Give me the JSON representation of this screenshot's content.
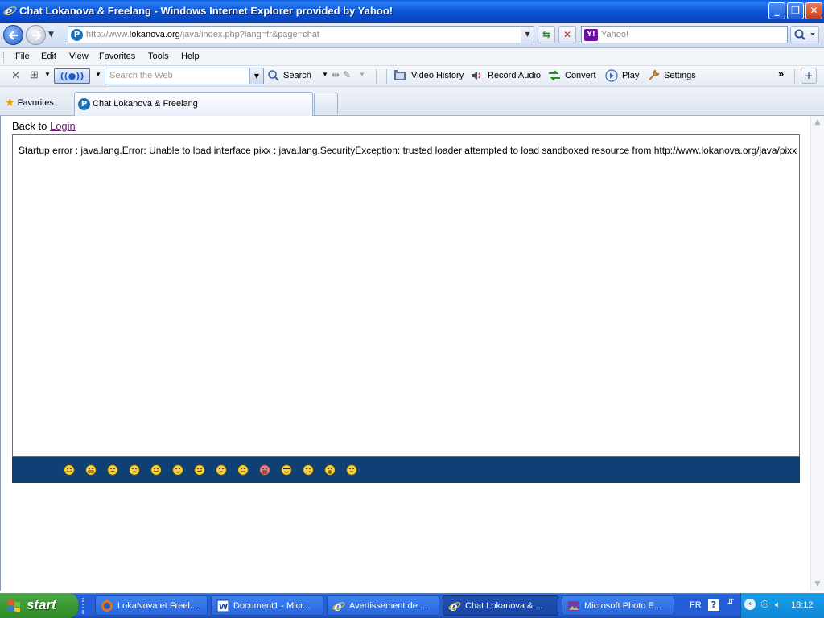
{
  "window": {
    "title": "Chat Lokanova & Freelang - Windows Internet Explorer provided by Yahoo!",
    "controls": {
      "minimize": "_",
      "maximize": "❐",
      "close": "✕"
    }
  },
  "address_bar": {
    "url_prefix": "http://www.",
    "url_host": "lokanova.org",
    "url_path": "/java/index.php?lang=fr&page=chat",
    "search_placeholder": "Yahoo!"
  },
  "menu": {
    "items": [
      "File",
      "Edit",
      "View",
      "Favorites",
      "Tools",
      "Help"
    ]
  },
  "toolbar": {
    "web_search_placeholder": "Search the Web",
    "search_label": "Search",
    "video_history_label": "Video History",
    "record_audio_label": "Record Audio",
    "convert_label": "Convert",
    "play_label": "Play",
    "settings_label": "Settings",
    "radio_label": "((●))",
    "more_label": "»"
  },
  "tabs": {
    "favorites_label": "Favorites",
    "active_tab_label": "Chat Lokanova & Freelang"
  },
  "page": {
    "back_text": "Back to ",
    "back_link": "Login",
    "error_text": "Startup error : java.lang.Error: Unable to load interface pixx : java.lang.SecurityException: trusted loader attempted to load sandboxed resource from http://www.lokanova.org/java/pixx"
  },
  "smileys": [
    "smile",
    "grin",
    "sad",
    "angry",
    "tongue",
    "wink",
    "confused",
    "cry",
    "annoyed",
    "red-face",
    "cool",
    "mad",
    "surprised",
    "roll-eyes"
  ],
  "taskbar": {
    "start_label": "start",
    "tasks": [
      {
        "label": "LokaNova et Freel...",
        "icon": "firefox-icon",
        "active": false
      },
      {
        "label": "Document1 - Micr...",
        "icon": "word-icon",
        "active": false
      },
      {
        "label": "Avertissement de ...",
        "icon": "ie-icon",
        "active": false
      },
      {
        "label": "Chat Lokanova & ...",
        "icon": "ie-icon",
        "active": true
      },
      {
        "label": "Microsoft Photo E...",
        "icon": "photo-editor-icon",
        "active": false
      }
    ],
    "language": "FR",
    "clock": "18:12"
  },
  "colors": {
    "title_bar": "#0b56d8",
    "smiley_bar": "#0e3f75",
    "start_button": "#3c9c34",
    "taskbar": "#245dd6",
    "link_visited": "#6c1a73"
  }
}
